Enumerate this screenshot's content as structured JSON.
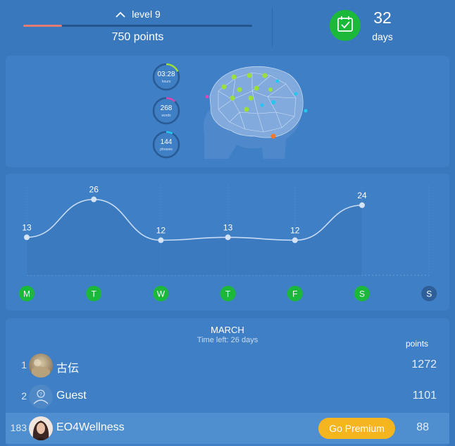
{
  "header": {
    "level_label": "level 9",
    "level_progress": 0.17,
    "points_label": "750 points",
    "streak_days": "32",
    "streak_unit": "days"
  },
  "stats": [
    {
      "value": "03:28",
      "label": "hours",
      "color": "#9be03a",
      "fraction": 0.18
    },
    {
      "value": "268",
      "label": "words",
      "color": "#e046b8",
      "fraction": 0.12
    },
    {
      "value": "144",
      "label": "phrases",
      "color": "#22c8f0",
      "fraction": 0.08
    }
  ],
  "chart_data": {
    "type": "line",
    "categories": [
      "M",
      "T",
      "W",
      "T",
      "F",
      "S",
      "S"
    ],
    "values": [
      13,
      26,
      12,
      13,
      12,
      24,
      null
    ],
    "data_labels": [
      "13",
      "26",
      "12",
      "13",
      "12",
      "24",
      ""
    ],
    "active_days": [
      true,
      true,
      true,
      true,
      true,
      true,
      false
    ],
    "ylim": [
      0,
      30
    ]
  },
  "leaderboard": {
    "month": "MARCH",
    "time_left": "Time left: 26 days",
    "points_header": "points",
    "premium_label": "Go Premium",
    "rows": [
      {
        "rank": "1",
        "name": "古伝",
        "points": "1272",
        "avatar": "photo"
      },
      {
        "rank": "2",
        "name": "Guest",
        "points": "1101",
        "avatar": "guest-icon"
      },
      {
        "rank": "183",
        "name": "EO4Wellness",
        "points": "88",
        "avatar": "photo"
      }
    ]
  },
  "colors": {
    "background": "#3a78bd",
    "card": "#3f7fc5",
    "active_day": "#1bb83a",
    "inactive_day": "#2e5f99",
    "premium": "#f5b51f",
    "level_fill": "#e57c73"
  }
}
